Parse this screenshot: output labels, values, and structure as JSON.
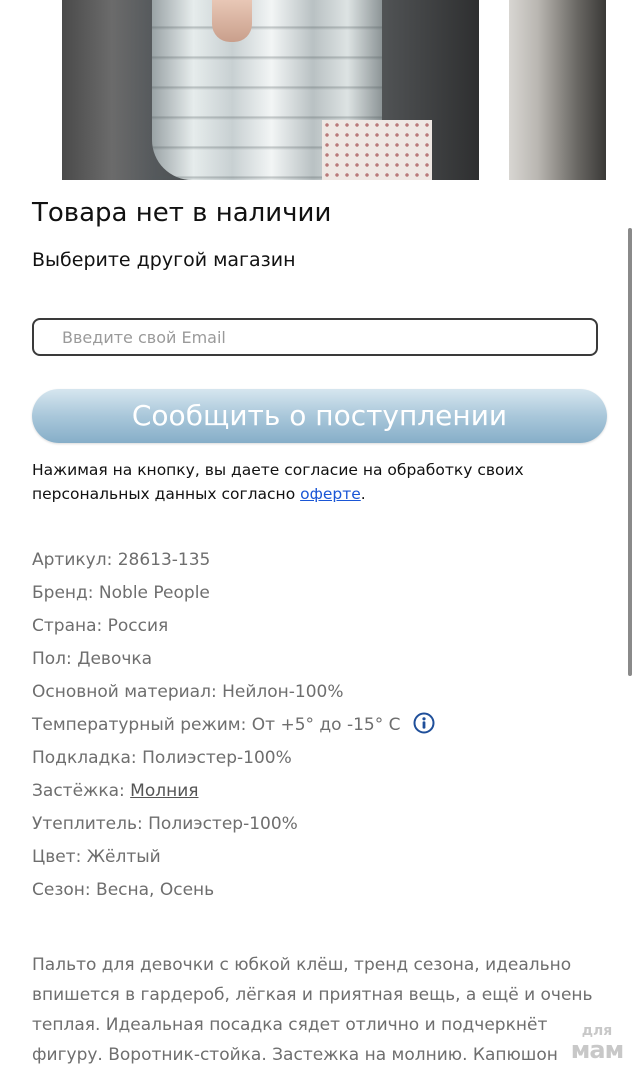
{
  "gallery": {
    "images": [
      {
        "alt": "product-photo-main"
      },
      {
        "alt": "product-photo-next"
      }
    ]
  },
  "availability": {
    "title": "Товара нет в наличии",
    "subtitle": "Выберите другой магазин"
  },
  "notify_form": {
    "email_placeholder": "Введите свой Email",
    "email_value": "",
    "button_label": "Сообщить о поступлении",
    "consent_text": "Нажимая на кнопку, вы даете согласие на обработку своих персональных данных согласно ",
    "consent_link": "оферте",
    "consent_end": "."
  },
  "specs": [
    {
      "label": "Артикул:",
      "value": "28613-135"
    },
    {
      "label": "Бренд:",
      "value": "Noble People"
    },
    {
      "label": "Страна:",
      "value": "Россия"
    },
    {
      "label": "Пол:",
      "value": "Девочка"
    },
    {
      "label": "Основной материал:",
      "value": "Нейлон-100%"
    },
    {
      "label": "Температурный режим:",
      "value": "От +5° до -15° С",
      "icon": "info-icon"
    },
    {
      "label": "Подкладка:",
      "value": "Полиэстер-100%"
    },
    {
      "label": "Застёжка:",
      "value": "Молния",
      "link": true
    },
    {
      "label": "Утеплитель:",
      "value": "Полиэстер-100%"
    },
    {
      "label": "Цвет:",
      "value": "Жёлтый"
    },
    {
      "label": "Сезон:",
      "value": "Весна, Осень"
    }
  ],
  "description": "Пальто для девочки с юбкой клёш, тренд сезона, идеально впишется в гардероб, лёгкая и приятная вещь, а ещё и очень теплая. Идеальная посадка сядет отлично и подчеркнёт фигуру. Воротник-стойка. Застежка на молнию. Капюшон отстегивается.",
  "watermark": {
    "top": "для",
    "bottom": "мам"
  },
  "colors": {
    "link": "#1a56d6",
    "button_gradient_top": "#d6e6ef",
    "button_gradient_bottom": "#86aec8",
    "info_icon": "#1f4f9a",
    "spec_text": "#6e6e6e"
  }
}
